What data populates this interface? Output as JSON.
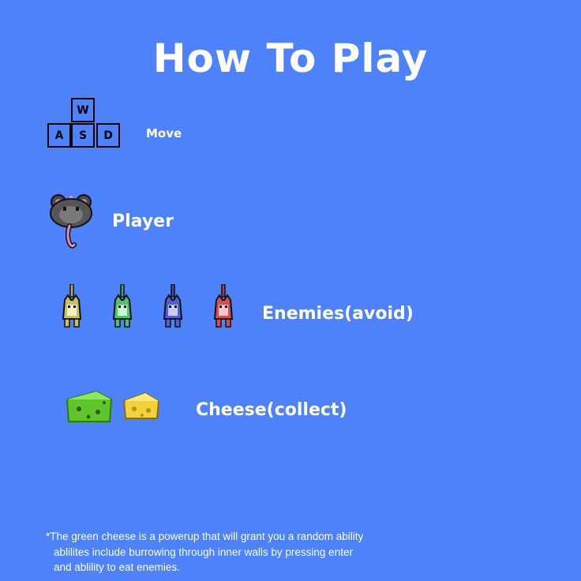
{
  "title": "How To Play",
  "controls": {
    "keys": {
      "up": "W",
      "left": "A",
      "down": "S",
      "right": "D"
    },
    "label": "Move"
  },
  "player": {
    "label": "Player",
    "icon": "rat-icon"
  },
  "enemies": {
    "label": "Enemies(avoid)",
    "items": [
      {
        "name": "yellow-cat-icon",
        "color": "#c8c25a"
      },
      {
        "name": "green-cat-icon",
        "color": "#4fc46a"
      },
      {
        "name": "blue-cat-icon",
        "color": "#4f5fd6"
      },
      {
        "name": "red-cat-icon",
        "color": "#d05050"
      }
    ]
  },
  "cheese": {
    "label": "Cheese(collect)",
    "items": [
      {
        "name": "green-cheese-icon",
        "color": "#5ec62a"
      },
      {
        "name": "yellow-cheese-icon",
        "color": "#f2d23a"
      }
    ]
  },
  "footnote": {
    "line1": "*The green cheese is a powerup that will grant you a random ability",
    "line2": "ablilites include burrowing through inner walls by pressing enter",
    "line3": "and ablility to eat enemies."
  }
}
